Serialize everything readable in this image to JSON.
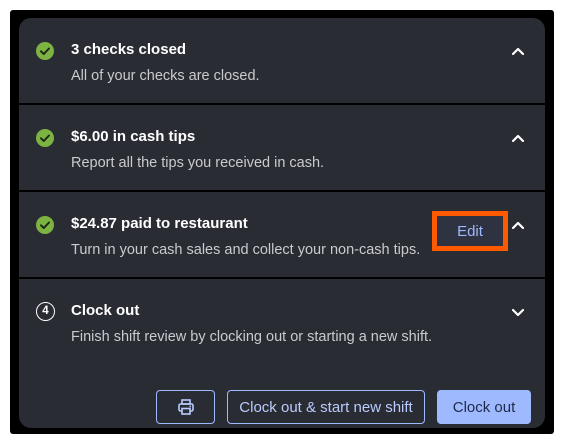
{
  "colors": {
    "check_green": "#7cb342",
    "accent_blue": "#9fb9ff",
    "highlight_orange": "#ff5a00",
    "panel_bg": "#2a2c33"
  },
  "sections": [
    {
      "icon": "check-circle-icon",
      "title": "3 checks closed",
      "description": "All of your checks are closed.",
      "expanded": true
    },
    {
      "icon": "check-circle-icon",
      "title": "$6.00 in cash tips",
      "description": "Report all the tips you received in cash.",
      "expanded": true
    },
    {
      "icon": "check-circle-icon",
      "title": "$24.87 paid to restaurant",
      "description": "Turn in your cash sales and collect your non-cash tips.",
      "action_label": "Edit",
      "expanded": true
    },
    {
      "step_number": "4",
      "title": "Clock out",
      "description": "Finish shift review by clocking out or starting a new shift.",
      "expanded": false
    }
  ],
  "actions": {
    "print_icon": "printer-icon",
    "clock_out_new_shift_label": "Clock out & start new shift",
    "clock_out_label": "Clock out"
  }
}
